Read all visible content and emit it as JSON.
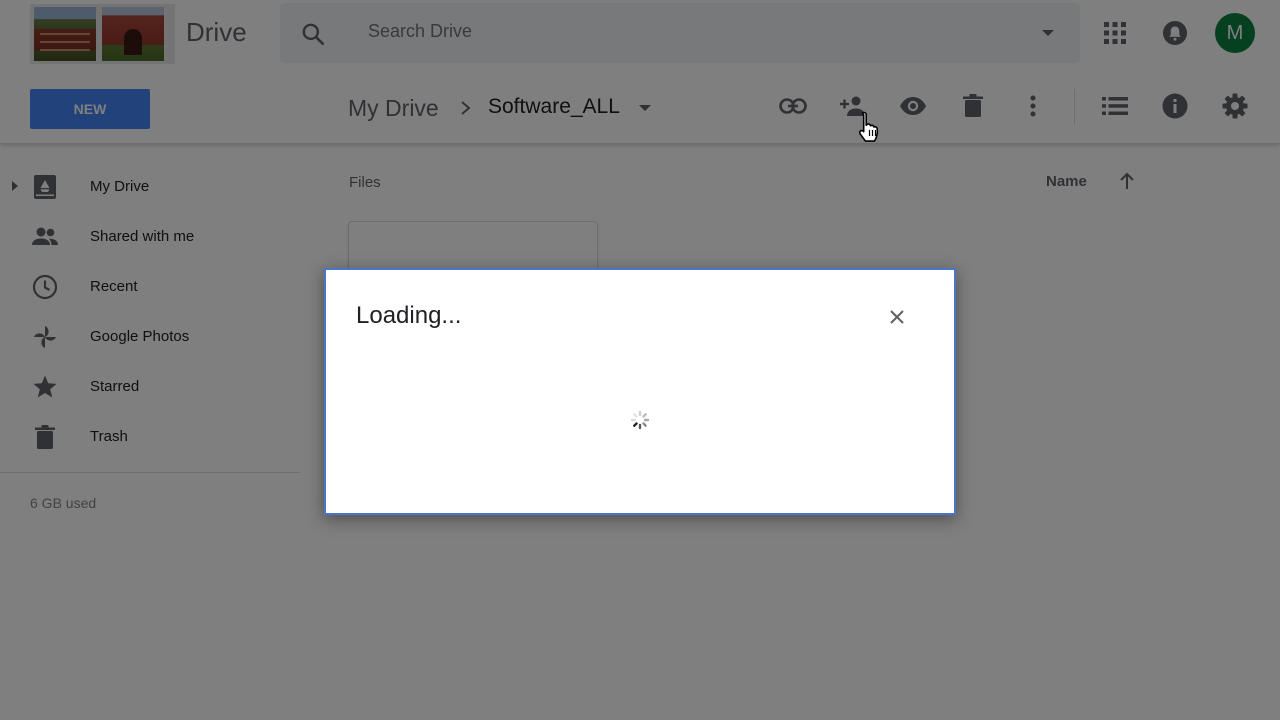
{
  "header": {
    "app_name": "Drive",
    "search": {
      "placeholder": "Search Drive"
    },
    "avatar_initial": "M"
  },
  "toolbar": {
    "new_label": "NEW",
    "breadcrumb": {
      "root": "My Drive",
      "current": "Software_ALL"
    }
  },
  "sidebar": {
    "items": [
      {
        "label": "My Drive",
        "icon": "drive-icon"
      },
      {
        "label": "Shared with me",
        "icon": "people-icon"
      },
      {
        "label": "Recent",
        "icon": "clock-icon"
      },
      {
        "label": "Google Photos",
        "icon": "pinwheel-icon"
      },
      {
        "label": "Starred",
        "icon": "star-icon"
      },
      {
        "label": "Trash",
        "icon": "trash-icon"
      }
    ],
    "storage": "6 GB used"
  },
  "main": {
    "section_label": "Files",
    "sort_label": "Name",
    "sort_direction": "ascending"
  },
  "dialog": {
    "title": "Loading..."
  },
  "colors": {
    "accent": "#4285f4",
    "avatar": "#0b8043",
    "overlay": "rgba(0,0,0,0.5)"
  }
}
